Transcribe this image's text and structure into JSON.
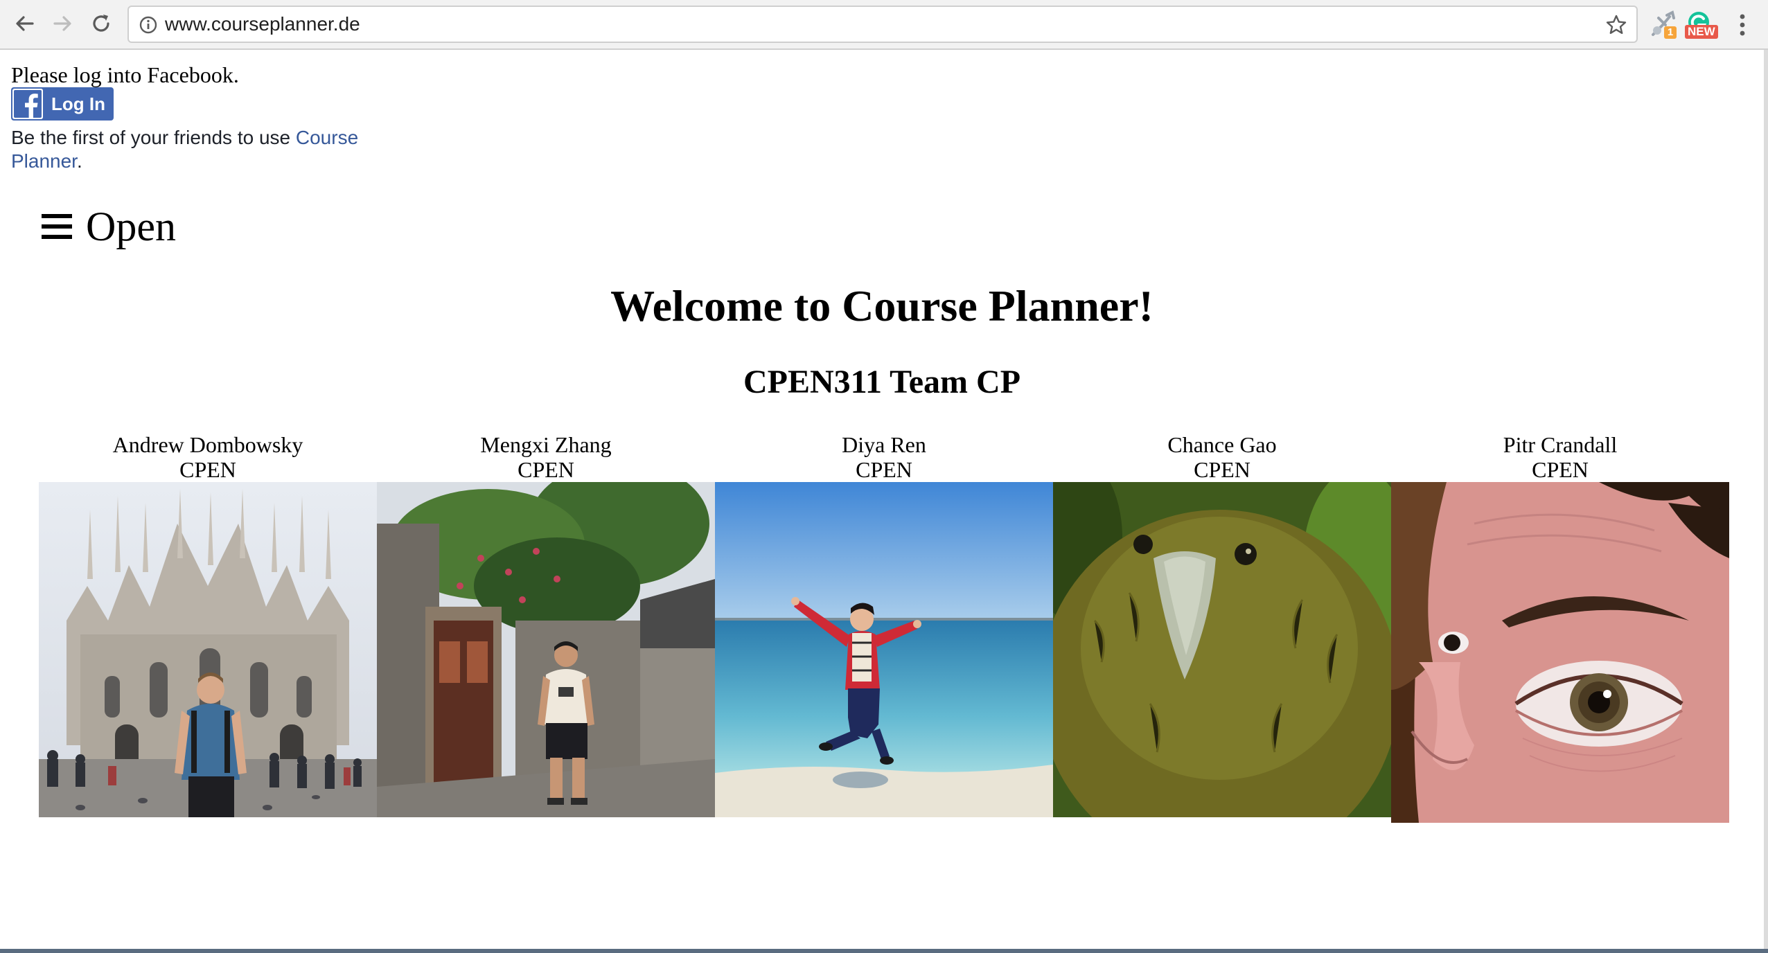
{
  "browser": {
    "url": "www.courseplanner.de",
    "extensions": {
      "badge_new": "NEW",
      "badge_count": "1"
    }
  },
  "facebook": {
    "prompt": "Please log into Facebook.",
    "login_label": "Log In",
    "social_prefix": "Be the first of your friends to use ",
    "social_link": "Course Planner",
    "social_suffix": "."
  },
  "menu": {
    "open_label": "Open"
  },
  "page": {
    "title": "Welcome to Course Planner!",
    "team": "CPEN311 Team CP"
  },
  "members": [
    {
      "name": "Andrew Dombowsky",
      "major": "CPEN"
    },
    {
      "name": "Mengxi Zhang",
      "major": "CPEN"
    },
    {
      "name": "Diya Ren",
      "major": "CPEN"
    },
    {
      "name": "Chance Gao",
      "major": "CPEN"
    },
    {
      "name": "Pitr Crandall",
      "major": "CPEN"
    }
  ]
}
